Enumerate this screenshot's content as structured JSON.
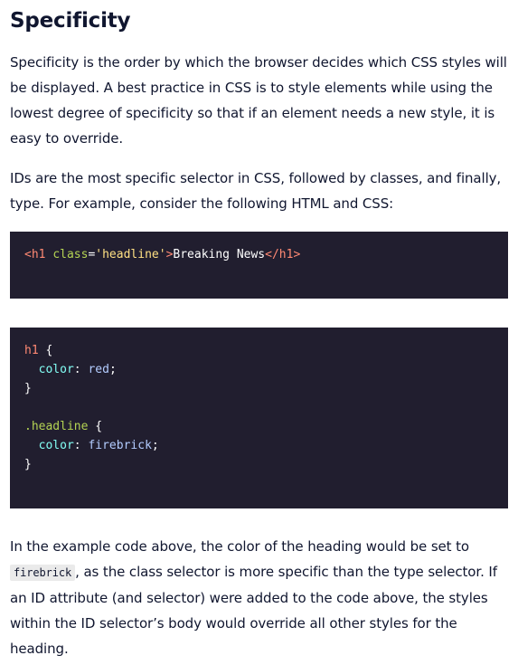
{
  "heading": "Specificity",
  "paragraph1": "Specificity is the order by which the browser decides which CSS styles will be displayed. A best practice in CSS is to style elements while using the lowest degree of specificity so that if an element needs a new style, it is easy to override.",
  "paragraph2": "IDs are the most specific selector in CSS, followed by classes, and finally, type. For example, consider the following HTML and CSS:",
  "html_example": {
    "open_tag": "<h1",
    "space": " ",
    "attr": "class",
    "eq": "=",
    "attr_value": "'headline'",
    "gt": ">",
    "text": "Breaking News",
    "close_tag": "</h1>"
  },
  "css_example": {
    "rule1_selector": "h1",
    "rule1_open": " {",
    "rule1_property": "color",
    "rule1_colon": ": ",
    "rule1_value": "red",
    "rule1_semicolon": ";",
    "rule1_close": "}",
    "rule2_selector": ".headline",
    "rule2_open": " {",
    "rule2_property": "color",
    "rule2_colon": ": ",
    "rule2_value": "firebrick",
    "rule2_semicolon": ";",
    "rule2_close": "}"
  },
  "paragraph3": {
    "before": "In the example code above, the color of the heading would be set to ",
    "code": "firebrick",
    "after": ", as the class selector is more specific than the type selector. If an ID attribute (and selector) were added to the code above, the styles within the ID selector’s body would override all other styles for the heading."
  }
}
